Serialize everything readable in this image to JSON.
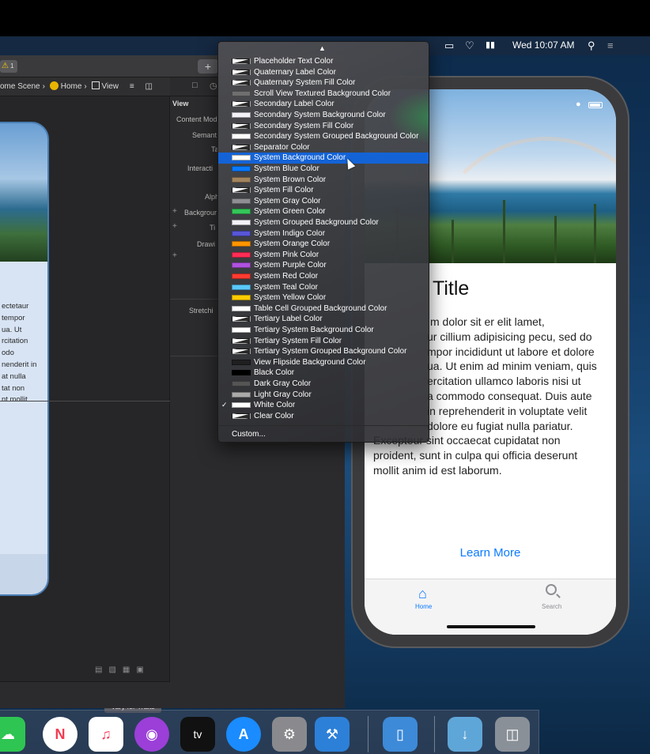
{
  "menubar": {
    "datetime": "Wed 10:07 AM"
  },
  "xcode": {
    "warning_count": "1",
    "jumpbar": [
      "ome Scene",
      "Home",
      "View"
    ],
    "inspector": {
      "section": "View",
      "labels": [
        "Content Mod",
        "Semant",
        "Ta",
        "Interacti",
        "Alph",
        "Backgrour",
        "Ti",
        "Drawi",
        "Stretchi"
      ]
    },
    "storyboard_text": [
      "ectetaur",
      "tempor",
      "ua. Ut",
      "rcitation",
      "odo",
      "nenderit in",
      "at nulla",
      "tat non",
      "nt mollit"
    ],
    "vary_for_traits": "Vary for Traits"
  },
  "color_menu": {
    "items": [
      {
        "label": "Placeholder Text Color",
        "swatch": "split",
        "color": "#b8b8b8"
      },
      {
        "label": "Quaternary Label Color",
        "swatch": "split",
        "color": "#d0d0d0"
      },
      {
        "label": "Quaternary System Fill Color",
        "swatch": "split",
        "color": "#e0e0e0"
      },
      {
        "label": "Scroll View Textured Background Color",
        "swatch": "solid",
        "color": "#6f6f6f"
      },
      {
        "label": "Secondary Label Color",
        "swatch": "split",
        "color": "#9a9a9a"
      },
      {
        "label": "Secondary System Background Color",
        "swatch": "solid",
        "color": "#f2f2f7"
      },
      {
        "label": "Secondary System Fill Color",
        "swatch": "split",
        "color": "#dcdcdc"
      },
      {
        "label": "Secondary System Grouped Background Color",
        "swatch": "solid",
        "color": "#ffffff"
      },
      {
        "label": "Separator Color",
        "swatch": "split",
        "color": "#c6c6c8"
      },
      {
        "label": "System Background Color",
        "swatch": "solid",
        "color": "#ffffff",
        "selected": true
      },
      {
        "label": "System Blue Color",
        "swatch": "solid",
        "color": "#0a7aff"
      },
      {
        "label": "System Brown Color",
        "swatch": "solid",
        "color": "#a2845e"
      },
      {
        "label": "System Fill Color",
        "swatch": "split",
        "color": "#d1d1d6"
      },
      {
        "label": "System Gray Color",
        "swatch": "solid",
        "color": "#8e8e93"
      },
      {
        "label": "System Green Color",
        "swatch": "solid",
        "color": "#34c759"
      },
      {
        "label": "System Grouped Background Color",
        "swatch": "solid",
        "color": "#f2f2f7"
      },
      {
        "label": "System Indigo Color",
        "swatch": "solid",
        "color": "#5856d6"
      },
      {
        "label": "System Orange Color",
        "swatch": "solid",
        "color": "#ff9500"
      },
      {
        "label": "System Pink Color",
        "swatch": "solid",
        "color": "#ff2d55"
      },
      {
        "label": "System Purple Color",
        "swatch": "solid",
        "color": "#af52de"
      },
      {
        "label": "System Red Color",
        "swatch": "solid",
        "color": "#ff3b30"
      },
      {
        "label": "System Teal Color",
        "swatch": "solid",
        "color": "#5ac8fa"
      },
      {
        "label": "System Yellow Color",
        "swatch": "solid",
        "color": "#ffcc00"
      },
      {
        "label": "Table Cell Grouped Background Color",
        "swatch": "solid",
        "color": "#ffffff"
      },
      {
        "label": "Tertiary Label Color",
        "swatch": "split",
        "color": "#c4c4c6"
      },
      {
        "label": "Tertiary System Background Color",
        "swatch": "solid",
        "color": "#ffffff"
      },
      {
        "label": "Tertiary System Fill Color",
        "swatch": "split",
        "color": "#e5e5ea"
      },
      {
        "label": "Tertiary System Grouped Background Color",
        "swatch": "split",
        "color": "#f2f2f7"
      },
      {
        "label": "View Flipside Background Color",
        "swatch": "solid",
        "color": "#1f1f21"
      },
      {
        "label": "Black Color",
        "swatch": "solid",
        "color": "#000000"
      },
      {
        "label": "Dark Gray Color",
        "swatch": "solid",
        "color": "#555555"
      },
      {
        "label": "Light Gray Color",
        "swatch": "solid",
        "color": "#aaaaaa"
      },
      {
        "label": "White Color",
        "swatch": "solid",
        "color": "#ffffff",
        "checked": true
      },
      {
        "label": "Clear Color",
        "swatch": "split",
        "color": "#ffffff"
      }
    ],
    "custom_label": "Custom..."
  },
  "simulator": {
    "title": "Title",
    "body_lines": [
      "m dolor sit er elit lamet,",
      "ur cillium adipisicing pecu, sed do",
      "mpor incididunt ut labore et dolore",
      "ua. Ut enim ad minim veniam, quis",
      "ercitation ullamco laboris nisi ut",
      "a commodo consequat. Duis aute",
      "in reprehenderit in voluptate velit",
      "dolore eu fugiat nulla pariatur.",
      "Excepteur sint occaecat cupidatat non",
      "proident, sunt in culpa qui officia deserunt",
      "mollit anim id est laborum."
    ],
    "learn_more": "Learn More",
    "tabs": {
      "home": "Home",
      "search": "Search"
    }
  },
  "dock": {
    "apps": [
      "messages",
      "news",
      "music",
      "podcasts",
      "tv",
      "app-store",
      "system-preferences",
      "xcode",
      "simulator",
      "downloads",
      "trash"
    ],
    "tv_label": "tv"
  }
}
